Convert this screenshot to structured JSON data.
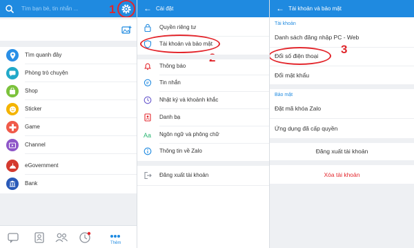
{
  "colors": {
    "accent": "#1f8ae0",
    "annotation": "#e3262c",
    "danger": "#e3262c"
  },
  "annotations": {
    "step1": "1",
    "step2": "2",
    "step3": "3"
  },
  "panel1": {
    "search_placeholder": "Tìm bạn bè, tin nhắn ...",
    "items": [
      {
        "label": "Tìm quanh đây",
        "icon": "location-icon",
        "color": "#2a8fe6"
      },
      {
        "label": "Phòng trò chuyện",
        "icon": "chat-room-icon",
        "color": "#21a9c9"
      },
      {
        "label": "Shop",
        "icon": "shop-icon",
        "color": "#7cc23c"
      },
      {
        "label": "Sticker",
        "icon": "sticker-icon",
        "color": "#f4b400"
      },
      {
        "label": "Game",
        "icon": "game-icon",
        "color": "#f05a4a"
      },
      {
        "label": "Channel",
        "icon": "channel-icon",
        "color": "#8e56c8"
      },
      {
        "label": "eGovernment",
        "icon": "egovernment-icon",
        "color": "#d43a2f"
      },
      {
        "label": "Bank",
        "icon": "bank-icon",
        "color": "#2a5ab8"
      }
    ],
    "active_tab_label": "Thêm"
  },
  "panel2": {
    "title": "Cài đặt",
    "items": [
      {
        "label": "Quyền riêng tư",
        "icon": "lock-icon"
      },
      {
        "label": "Tài khoản và bảo mật",
        "icon": "shield-icon"
      },
      {
        "label": "Thông báo",
        "icon": "bell-icon"
      },
      {
        "label": "Tin nhắn",
        "icon": "message-icon"
      },
      {
        "label": "Nhật ký và khoảnh khắc",
        "icon": "clock-icon"
      },
      {
        "label": "Danh bạ",
        "icon": "contacts-icon"
      },
      {
        "label": "Ngôn ngữ và phông chữ",
        "icon": "font-icon"
      },
      {
        "label": "Thông tin về Zalo",
        "icon": "info-icon"
      },
      {
        "label": "Đăng xuất tài khoản",
        "icon": "logout-icon"
      }
    ]
  },
  "panel3": {
    "title": "Tài khoản và bảo mật",
    "section_account": "Tài khoản",
    "login_devices": "Danh sách đăng nhập PC - Web",
    "change_phone": "Đổi số điện thoại",
    "change_password": "Đổi mật khẩu",
    "section_security": "Bảo mật",
    "lock_code": "Đặt mã khóa Zalo",
    "granted_apps": "Ứng dụng đã cấp quyền",
    "logout": "Đăng xuất tài khoản",
    "delete_account": "Xóa tài khoản"
  }
}
